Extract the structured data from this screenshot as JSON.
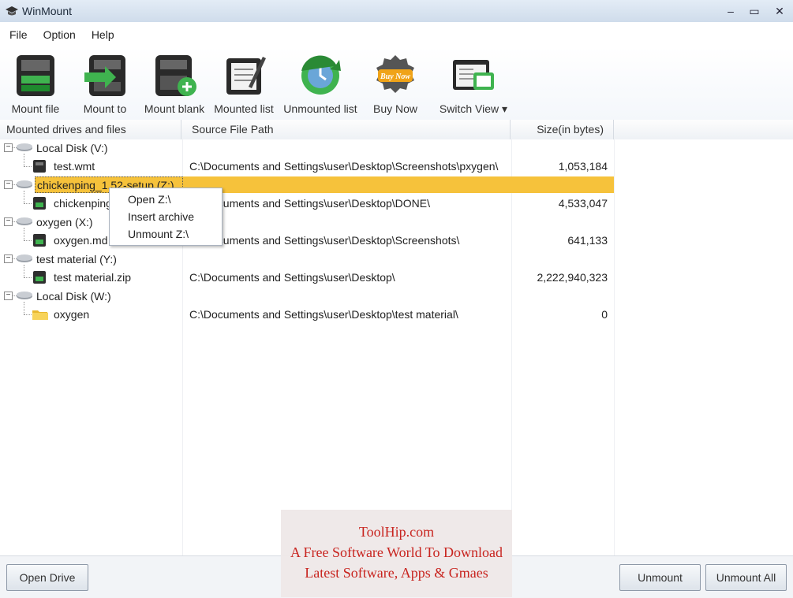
{
  "window": {
    "title": "WinMount"
  },
  "menu": [
    "File",
    "Option",
    "Help"
  ],
  "toolbar": [
    {
      "label": "Mount file",
      "icon": "mount-file-icon"
    },
    {
      "label": "Mount to",
      "icon": "mount-to-icon"
    },
    {
      "label": "Mount blank",
      "icon": "mount-blank-icon"
    },
    {
      "label": "Mounted list",
      "icon": "mounted-list-icon"
    },
    {
      "label": "Unmounted list",
      "icon": "unmounted-list-icon"
    },
    {
      "label": "Buy Now",
      "icon": "buy-now-cart-icon"
    },
    {
      "label": "Switch View ▾",
      "icon": "switch-view-icon"
    }
  ],
  "buy_now_badge": "Buy Now",
  "columns": [
    "Mounted drives and files",
    "Source File Path",
    "Size(in bytes)"
  ],
  "rows": [
    {
      "type": "drive",
      "name": "Local Disk (V:)",
      "path": "",
      "size": ""
    },
    {
      "type": "file",
      "name": "test.wmt",
      "path": "C:\\Documents and Settings\\user\\Desktop\\Screenshots\\pxygen\\",
      "size": "1,053,184"
    },
    {
      "type": "drive",
      "name": "chickenping_1.52-setup (Z:)",
      "path": "",
      "size": "",
      "selected": true
    },
    {
      "type": "file",
      "name": "chickenping",
      "path": "C:\\Documents and Settings\\user\\Desktop\\DONE\\",
      "size": "4,533,047"
    },
    {
      "type": "drive",
      "name": "oxygen (X:)",
      "path": "",
      "size": ""
    },
    {
      "type": "file",
      "name": "oxygen.md",
      "path": "C:\\Documents and Settings\\user\\Desktop\\Screenshots\\",
      "size": "641,133"
    },
    {
      "type": "drive",
      "name": "test material (Y:)",
      "path": "",
      "size": ""
    },
    {
      "type": "file",
      "name": "test material.zip",
      "path": "C:\\Documents and Settings\\user\\Desktop\\",
      "size": "2,222,940,323"
    },
    {
      "type": "drive",
      "name": "Local Disk (W:)",
      "path": "",
      "size": ""
    },
    {
      "type": "folder",
      "name": "oxygen",
      "path": "C:\\Documents and Settings\\user\\Desktop\\test material\\",
      "size": "0"
    }
  ],
  "context_menu": [
    "Open Z:\\",
    "Insert archive",
    "Unmount Z:\\"
  ],
  "buttons": {
    "open_drive": "Open Drive",
    "unmount": "Unmount",
    "unmount_all": "Unmount All"
  },
  "watermark": [
    "ToolHip.com",
    "A Free Software World To Download",
    "Latest Software, Apps & Gmaes"
  ],
  "colors": {
    "selection": "#f6c23b",
    "watermark_text": "#c8241f"
  }
}
